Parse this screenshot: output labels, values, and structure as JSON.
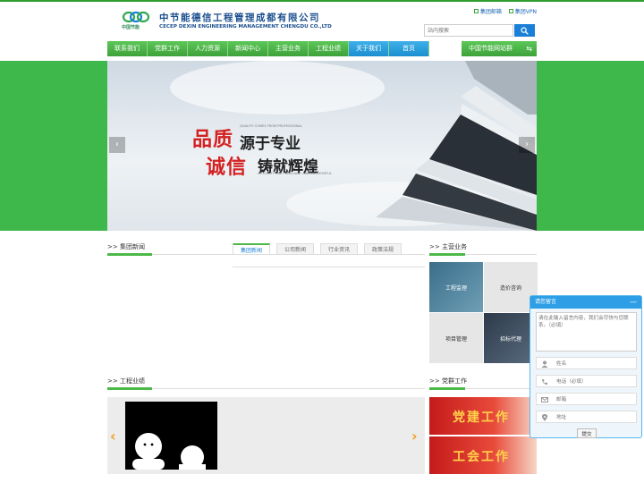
{
  "header": {
    "logo_text": "中国节能",
    "company_cn": "中节能德信工程管理成都有限公司",
    "company_en": "CECEP DEXIN ENGINEERING MANAGEMENT CHENGDU CO.,LTD",
    "links": [
      "集团邮箱",
      "集团VPN"
    ]
  },
  "search": {
    "placeholder": "站内搜索",
    "icon": "search-icon"
  },
  "nav": {
    "items": [
      "联系我们",
      "党群工作",
      "人力资源",
      "新闻中心",
      "主营业务",
      "工程业绩",
      "关于我们",
      "首页"
    ],
    "site_group": "中国节能网站群"
  },
  "banner": {
    "line1_red": "品质",
    "line1_dark": "源于专业",
    "line1_tag": "QUALITY COMES FROM PROFESSIONAL",
    "line2_red": "诚信",
    "line2_dark": "铸就辉煌",
    "line2_tag": "INTEGRITY CAST BRILLIANT AND SUCCESSFUL"
  },
  "sections": {
    "group_news": ">> 集团新闻",
    "main_business": ">> 主营业务",
    "projects": ">> 工程业绩",
    "party_work": ">> 党群工作"
  },
  "news_tabs": [
    "集团新闻",
    "公司新闻",
    "行业资讯",
    "政策法规"
  ],
  "business_tiles": [
    "工程监理",
    "造价咨询",
    "项目管理",
    "招标代理"
  ],
  "party_items": [
    "党建工作",
    "工会工作"
  ],
  "message": {
    "title": "请您留言",
    "placeholder": "请在此输入留言内容，我们会尽快与您联系。（必填）",
    "fields": [
      "姓名",
      "电话（必填）",
      "邮箱",
      "地址"
    ],
    "submit": "提交"
  },
  "colors": {
    "green": "#4cb848",
    "blue": "#1a8fd0",
    "brand": "#1b4f8f"
  }
}
